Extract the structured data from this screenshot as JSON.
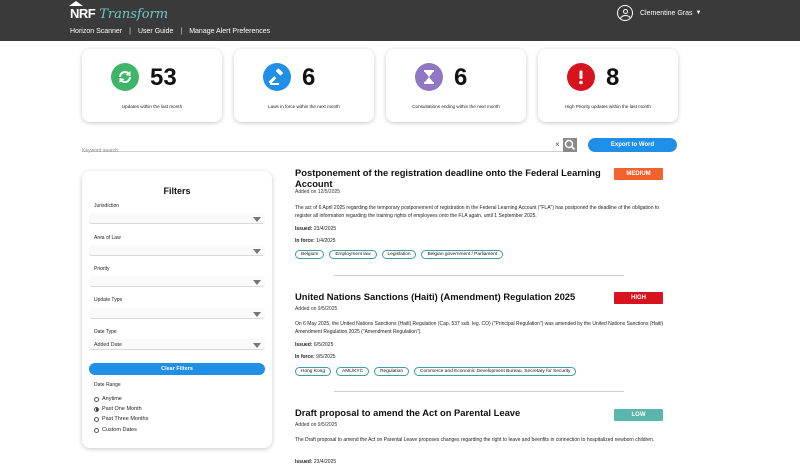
{
  "header": {
    "logo_nrf": "NRF",
    "logo_transform": "Transform",
    "nav": [
      "Horizon Scanner",
      "User Guide",
      "Manage Alert Preferences"
    ],
    "user_name": "Clementine Gras"
  },
  "stats": [
    {
      "value": "53",
      "label": "Updates within the last month",
      "icon": "refresh-icon",
      "color": "#3fb56a"
    },
    {
      "value": "6",
      "label": "Laws in force within the next month",
      "icon": "gavel-icon",
      "color": "#1f8fe8"
    },
    {
      "value": "6",
      "label": "Consultations ending within the next month",
      "icon": "hourglass-icon",
      "color": "#8f77c4"
    },
    {
      "value": "8",
      "label": "High Priority updates within the last month",
      "icon": "alert-icon",
      "color": "#d6131e"
    }
  ],
  "search": {
    "placeholder": "Keyword search",
    "clear": "×"
  },
  "export_label": "Export to Word",
  "filters": {
    "title": "Filters",
    "jurisdiction_label": "Jurisdiction",
    "area_label": "Area of Law",
    "priority_label": "Priority",
    "update_type_label": "Update Type",
    "date_type_label": "Date Type",
    "date_type_value": "Added Date",
    "clear_label": "Clear Filters",
    "date_range_label": "Date Range",
    "date_range_options": [
      "Anytime",
      "Past One Month",
      "Past Three Months",
      "Custom Dates"
    ],
    "date_range_selected": "Past One Month"
  },
  "articles": [
    {
      "title": "Postponement of the registration deadline onto the Federal Learning Account",
      "added": "Added on 12/5/2025",
      "priority": "MEDIUM",
      "priority_color": "#f2622d",
      "description": "The act of 6 April 2025 regarding the temporary postponement of registration in the Federal Learning Account (\"FLA\") has postponed the deadline of the obligation to register all information regarding the training rights of employees onto the FLA again, until 1 September 2025.",
      "issued_label": "Issued:",
      "issued": "23/4/2025",
      "inforce_label": "In force:",
      "inforce": "1/4/2025",
      "tags": [
        "Belgium",
        "Employment law",
        "Legislation",
        "Belgian government / Parliament"
      ]
    },
    {
      "title": "United Nations Sanctions (Haiti) (Amendment) Regulation 2025",
      "added": "Added on 9/5/2025",
      "priority": "HIGH",
      "priority_color": "#d6131e",
      "description": "On 6 May 2025, the United Nations Sanctions (Haiti) Regulation (Cap. 537 sub. leg. CO) (\"Principal Regulation\") was amended by the United Nations Sanctions (Haiti) Amendment Regulation 2025 (\"Amendment Regulation\").",
      "issued_label": "Issued:",
      "issued": "6/5/2025",
      "inforce_label": "In force:",
      "inforce": "9/5/2025",
      "tags": [
        "Hong Kong",
        "AML/KYC",
        "Regulation",
        "Commerce and Economic Development Bureau, Secretary for Security"
      ]
    },
    {
      "title": "Draft proposal to amend the Act on Parental Leave",
      "added": "Added on 9/5/2025",
      "priority": "LOW",
      "priority_color": "#5ab5ad",
      "description": "The Draft proposal to amend the Act on Parental Leave proposes changes regarding the right to leave and beenfits in connection to hospitalized newborn children.",
      "issued_label": "Issued:",
      "issued": "23/4/2025"
    }
  ]
}
